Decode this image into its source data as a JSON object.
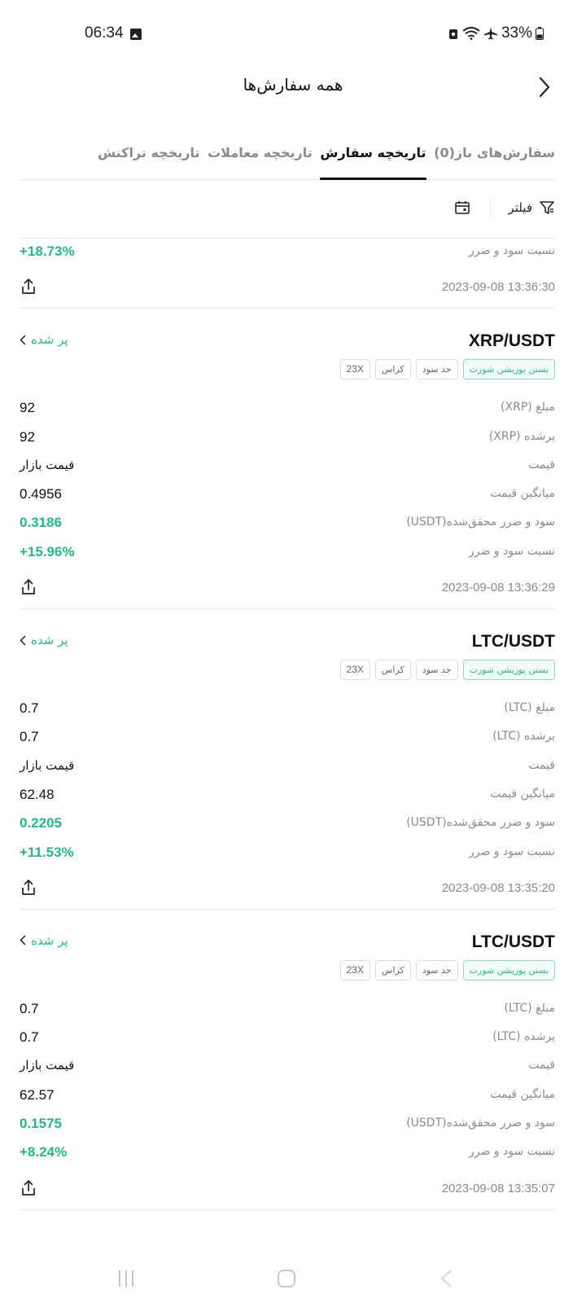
{
  "status_bar": {
    "time": "06:34",
    "battery": "33%"
  },
  "header": {
    "title": "همه سفارش‌ها"
  },
  "tabs": [
    {
      "label": "سفارش‌های باز(0)",
      "active": false
    },
    {
      "label": "تاریخچه سفارش",
      "active": true
    },
    {
      "label": "تاریخچه معاملات",
      "active": false
    },
    {
      "label": "تاریخچه تراکنش",
      "active": false
    }
  ],
  "filter": {
    "label": "فیلتر"
  },
  "partial_order": {
    "rows": [
      {
        "label": "نسبت سود و ضرر",
        "value": "+18.73%"
      }
    ],
    "timestamp": "2023-09-08 13:36:30"
  },
  "orders": [
    {
      "pair": "XRP/USDT",
      "status": "پر شده",
      "tags": [
        "بستن پوزیشن شورت",
        "حد سود",
        "کراس",
        "23X"
      ],
      "rows": [
        {
          "label": "مبلغ (XRP)",
          "value": "92"
        },
        {
          "label": "پرشده (XRP)",
          "value": "92"
        },
        {
          "label": "قیمت",
          "value": "قیمت بازار"
        },
        {
          "label": "میانگین قیمت",
          "value": "0.4956"
        },
        {
          "label": "سود و ضرر محقق‌شده(USDT)",
          "value": "0.3186"
        },
        {
          "label": "نسبت سود و ضرر",
          "value": "+15.96%"
        }
      ],
      "timestamp": "2023-09-08 13:36:29"
    },
    {
      "pair": "LTC/USDT",
      "status": "پر شده",
      "tags": [
        "بستن پوزیشن شورت",
        "حد سود",
        "کراس",
        "23X"
      ],
      "rows": [
        {
          "label": "مبلغ (LTC)",
          "value": "0.7"
        },
        {
          "label": "پرشده (LTC)",
          "value": "0.7"
        },
        {
          "label": "قیمت",
          "value": "قیمت بازار"
        },
        {
          "label": "میانگین قیمت",
          "value": "62.48"
        },
        {
          "label": "سود و ضرر محقق‌شده(USDT)",
          "value": "0.2205"
        },
        {
          "label": "نسبت سود و ضرر",
          "value": "+11.53%"
        }
      ],
      "timestamp": "2023-09-08 13:35:20"
    },
    {
      "pair": "LTC/USDT",
      "status": "پر شده",
      "tags": [
        "بستن پوزیشن شورت",
        "حد سود",
        "کراس",
        "23X"
      ],
      "rows": [
        {
          "label": "مبلغ (LTC)",
          "value": "0.7"
        },
        {
          "label": "پرشده (LTC)",
          "value": "0.7"
        },
        {
          "label": "قیمت",
          "value": "قیمت بازار"
        },
        {
          "label": "میانگین قیمت",
          "value": "62.57"
        },
        {
          "label": "سود و ضرر محقق‌شده(USDT)",
          "value": "0.1575"
        },
        {
          "label": "نسبت سود و ضرر",
          "value": "+8.24%"
        }
      ],
      "timestamp": "2023-09-08 13:35:07"
    }
  ],
  "colors": {
    "accent_green": "#29b585",
    "text_primary": "#111111",
    "text_secondary": "#8a8a8a"
  },
  "icons": [
    "gallery-icon",
    "alarm-icon",
    "wifi-icon",
    "airplane-icon",
    "battery-icon",
    "chevron-right-icon",
    "filter-icon",
    "calendar-icon",
    "share-icon",
    "chevron-left-icon",
    "nav-recents-icon",
    "nav-home-icon",
    "nav-back-icon"
  ]
}
